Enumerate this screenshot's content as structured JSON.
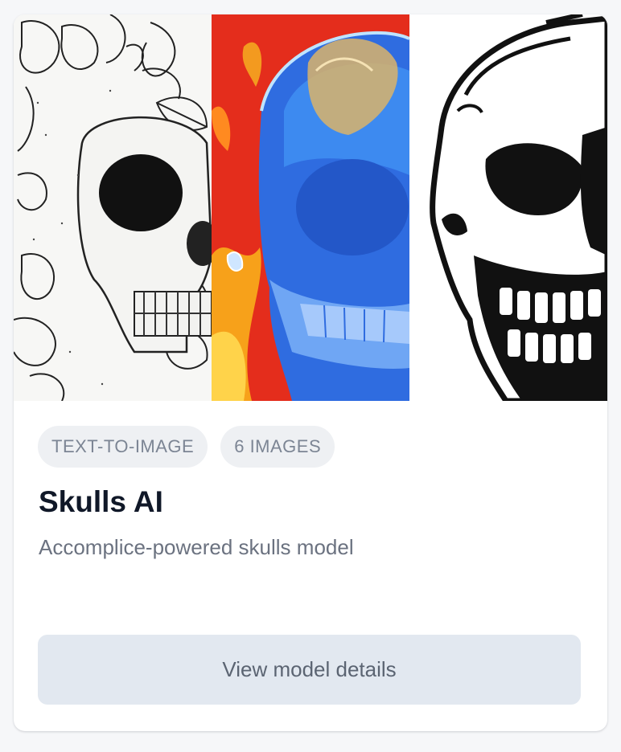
{
  "card": {
    "images": [
      {
        "name": "ink-floral-skull-image"
      },
      {
        "name": "blue-fire-skull-image"
      },
      {
        "name": "black-white-skull-image"
      }
    ],
    "tags": [
      "TEXT-TO-IMAGE",
      "6 IMAGES"
    ],
    "title": "Skulls AI",
    "description": "Accomplice-powered skulls model",
    "button_label": "View model details"
  },
  "colors": {
    "button_bg": "#e2e8f0",
    "tag_bg": "#eef0f3",
    "title": "#101828"
  }
}
